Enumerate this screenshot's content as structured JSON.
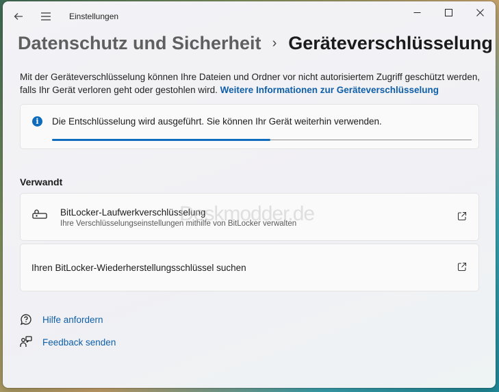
{
  "window": {
    "app_title": "Einstellungen"
  },
  "breadcrumb": {
    "parent": "Datenschutz und Sicherheit",
    "separator": "›",
    "current": "Geräteverschlüsselung"
  },
  "description": {
    "text": "Mit der Geräteverschlüsselung können Ihre Dateien und Ordner vor nicht autorisiertem Zugriff geschützt werden, falls Ihr Gerät verloren geht oder gestohlen wird.",
    "link": "Weitere Informationen zur Geräteverschlüsselung"
  },
  "status": {
    "message": "Die Entschlüsselung wird ausgeführt. Sie können Ihr Gerät weiterhin verwenden.",
    "progress_fraction": 0.52,
    "accent_color": "#0f6cbd",
    "icon": "info-icon"
  },
  "related": {
    "heading": "Verwandt",
    "bitlocker": {
      "title": "BitLocker-Laufwerkverschlüsselung",
      "subtitle": "Ihre Verschlüsselungseinstellungen mithilfe von BitLocker verwalten",
      "icon": "drive-lock-icon"
    },
    "recovery": {
      "title": "Ihren BitLocker-Wiederherstellungsschlüssel suchen"
    }
  },
  "watermark": "Deskmodder.de",
  "footer_links": [
    {
      "label": "Hilfe anfordern",
      "icon": "help-icon"
    },
    {
      "label": "Feedback senden",
      "icon": "feedback-icon"
    }
  ]
}
